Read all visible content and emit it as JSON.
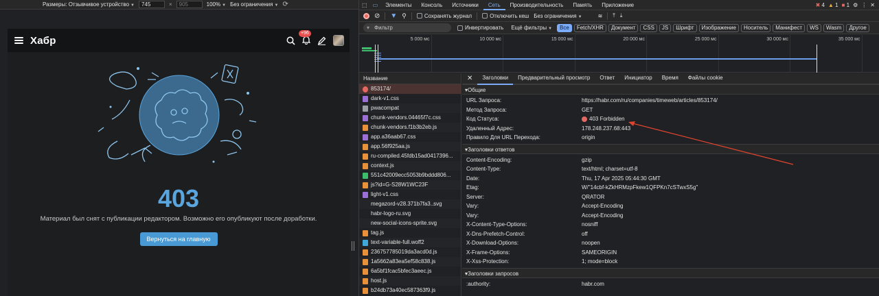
{
  "devbar": {
    "dimensions_label": "Размеры: Отзывчивое устройство",
    "width_value": "745",
    "height_placeholder": "905",
    "zoom": "100%",
    "throttle": "Без ограничения"
  },
  "habr": {
    "logo": "Хабр",
    "notif_badge": "+96",
    "error_code": "403",
    "message": "Материал был снят с публикации редактором. Возможно его опубликуют после доработки.",
    "home_button": "Вернуться на главную"
  },
  "devtools": {
    "tabs": [
      "Элементы",
      "Консоль",
      "Источники",
      "Сеть",
      "Производительность",
      "Память",
      "Приложение"
    ],
    "active_tab": "Сеть",
    "counts": {
      "errors": "4",
      "warnings": "1",
      "info": "1"
    },
    "toolbar": {
      "preserve_log": "Сохранять журнал",
      "disable_cache": "Отключить кеш",
      "throttle": "Без ограничения"
    },
    "filter_placeholder": "Фильтр",
    "invert": "Инвертировать",
    "all_filters": "Ещё фильтры",
    "type_chips": [
      "Все",
      "Fetch/XHR",
      "Документ",
      "CSS",
      "JS",
      "Шрифт",
      "Изображение",
      "Носитель",
      "Манифест",
      "WS",
      "Wasm",
      "Другое"
    ],
    "active_chip": "Все",
    "timeline_ticks": [
      "5 000 мс",
      "10 000 мс",
      "15 000 мс",
      "20 000 мс",
      "25 000 мс",
      "30 000 мс",
      "35 000 мс"
    ],
    "requests_header": "Название",
    "requests": [
      {
        "name": "853174/",
        "type": "error"
      },
      {
        "name": "dark-v1.css",
        "type": "css"
      },
      {
        "name": "pwacompat",
        "type": "doc"
      },
      {
        "name": "chunk-vendors.04465f7c.css",
        "type": "css"
      },
      {
        "name": "chunk-vendors.f1b3b2eb.js",
        "type": "js"
      },
      {
        "name": "app.a36aab67.css",
        "type": "css"
      },
      {
        "name": "app.56f925aa.js",
        "type": "js"
      },
      {
        "name": "ru-compiled.45fdb15ad0417396...",
        "type": "js"
      },
      {
        "name": "context.js",
        "type": "js"
      },
      {
        "name": "551c42009ecc5053b9bddd806...",
        "type": "img"
      },
      {
        "name": "js?id=G-S28W1WC23F",
        "type": "js"
      },
      {
        "name": "light-v1.css",
        "type": "css"
      },
      {
        "name": "megazord-v28.371b7fa3..svg",
        "type": "none"
      },
      {
        "name": "habr-logo-ru.svg",
        "type": "none"
      },
      {
        "name": "new-social-icons-sprite.svg",
        "type": "none"
      },
      {
        "name": "tag.js",
        "type": "js"
      },
      {
        "name": "text-variable-full.woff2",
        "type": "font"
      },
      {
        "name": "236757785019da3acd0d.js",
        "type": "js"
      },
      {
        "name": "1a5662a83ea5ef58c838.js",
        "type": "js"
      },
      {
        "name": "6a5bf1fcac5bfec3aeec.js",
        "type": "js"
      },
      {
        "name": "host.js",
        "type": "js"
      },
      {
        "name": "b24db73a40ec587363f9.js",
        "type": "js"
      }
    ],
    "detail_tabs": [
      "Заголовки",
      "Предварительный просмотр",
      "Ответ",
      "Инициатор",
      "Время",
      "Файлы cookie"
    ],
    "active_detail_tab": "Заголовки",
    "general_title": "Общие",
    "general": [
      {
        "k": "URL Запроса:",
        "v": "https://habr.com/ru/companies/timeweb/articles/853174/"
      },
      {
        "k": "Метод Запроса:",
        "v": "GET"
      },
      {
        "k": "Код Статуса:",
        "v": "403 Forbidden"
      },
      {
        "k": "Удаленный Адрес:",
        "v": "178.248.237.68:443"
      },
      {
        "k": "Правило Для URL Перехода:",
        "v": "origin"
      }
    ],
    "response_title": "Заголовки ответов",
    "response_headers": [
      {
        "k": "Content-Encoding:",
        "v": "gzip"
      },
      {
        "k": "Content-Type:",
        "v": "text/html; charset=utf-8"
      },
      {
        "k": "Date:",
        "v": "Thu, 17 Apr 2025 05:44:30 GMT"
      },
      {
        "k": "Etag:",
        "v": "W/\"14cbf-kZkHRMzpFkew1QFPKn7cSTwxS5g\""
      },
      {
        "k": "Server:",
        "v": "QRATOR"
      },
      {
        "k": "Vary:",
        "v": "Accept-Encoding"
      },
      {
        "k": "Vary:",
        "v": "Accept-Encoding"
      },
      {
        "k": "X-Content-Type-Options:",
        "v": "nosniff"
      },
      {
        "k": "X-Dns-Prefetch-Control:",
        "v": "off"
      },
      {
        "k": "X-Download-Options:",
        "v": "noopen"
      },
      {
        "k": "X-Frame-Options:",
        "v": "SAMEORIGIN"
      },
      {
        "k": "X-Xss-Protection:",
        "v": "1; mode=block"
      }
    ],
    "request_title": "Заголовки запросов",
    "request_headers": [
      {
        "k": ":authority:",
        "v": "habr.com"
      }
    ]
  },
  "colors": {
    "accent": "#7cacf8",
    "error": "#e46962",
    "habr_blue": "#5aa5dd",
    "arrow": "#e0442e"
  }
}
